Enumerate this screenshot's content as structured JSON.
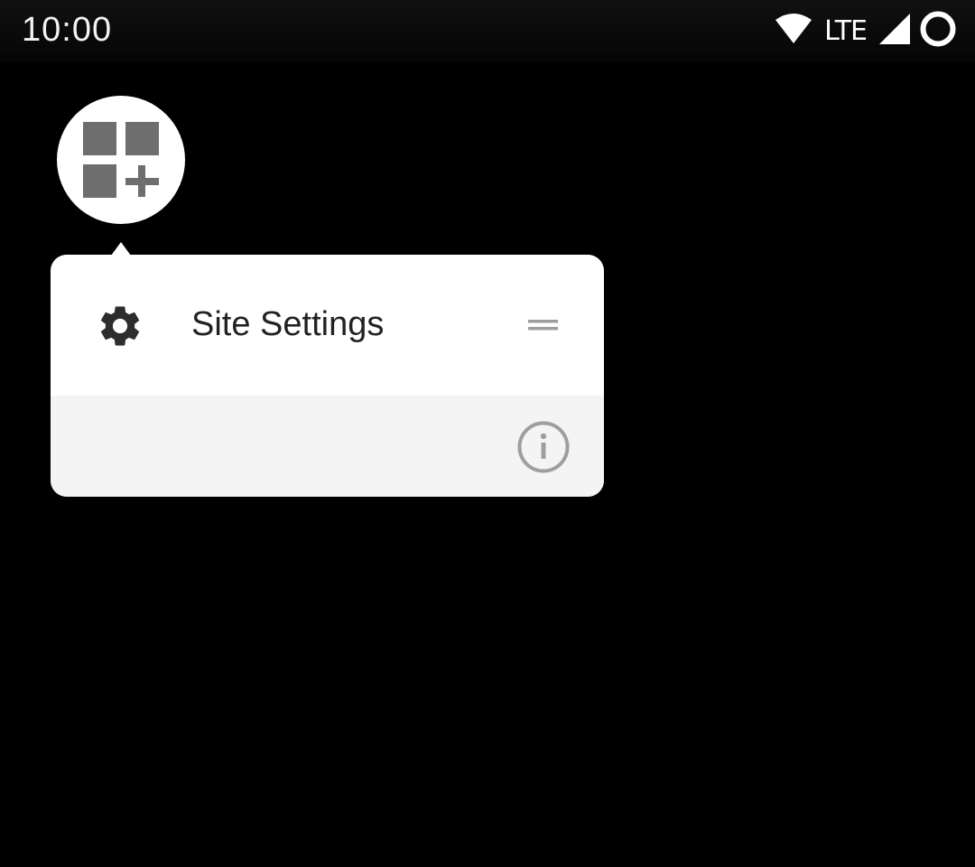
{
  "status_bar": {
    "time": "10:00",
    "network_label": "LTE",
    "icons": [
      "wifi-icon",
      "cellular-signal-icon",
      "battery-ring-icon"
    ]
  },
  "app_icon": {
    "icon": "widgets-add-icon"
  },
  "popup": {
    "items": [
      {
        "icon": "gear-icon",
        "label": "Site Settings",
        "trailing_icon": "drag-handle-icon"
      }
    ],
    "footer_icon": "info-icon"
  },
  "colors": {
    "background": "#000000",
    "popup_row": "#ffffff",
    "popup_footer": "#f4f4f4",
    "icon_grey": "#6e6e6e",
    "text_primary": "#222222",
    "light_grey_icon": "#9e9e9e"
  }
}
